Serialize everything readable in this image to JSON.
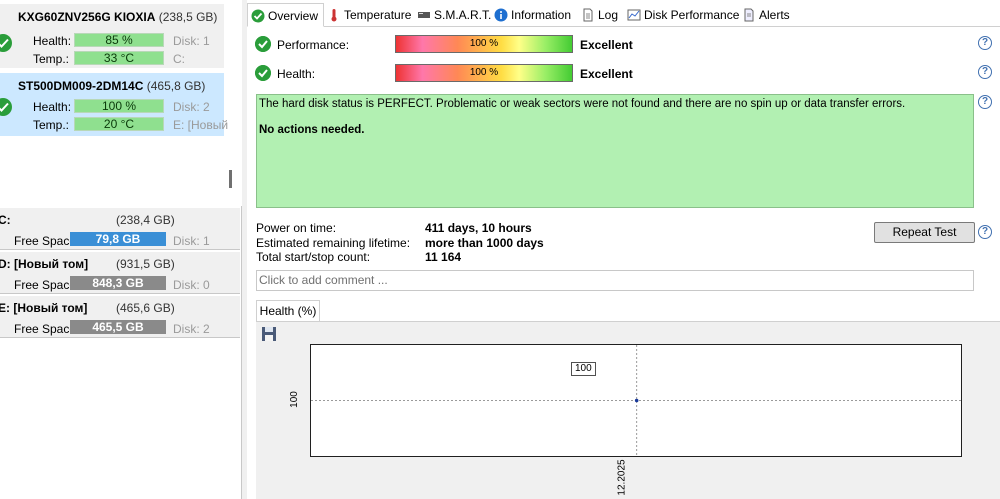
{
  "disks": [
    {
      "model": "KXG60ZNV256G KIOXIA",
      "capacity": "(238,5 GB)",
      "health_label": "Health:",
      "health": "85 %",
      "health_side": "Disk: 1",
      "temp_label": "Temp.:",
      "temp": "33 °C",
      "temp_side": "C:"
    },
    {
      "model": "ST500DM009-2DM14C",
      "capacity": "(465,8 GB)",
      "health_label": "Health:",
      "health": "100 %",
      "health_side": "Disk: 2",
      "temp_label": "Temp.:",
      "temp": "20 °C",
      "temp_side": "E: [Новый"
    }
  ],
  "volumes": [
    {
      "name": "C:",
      "capacity": "(238,4 GB)",
      "free_label": "Free Space",
      "free": "79,8 GB",
      "disk": "Disk: 1"
    },
    {
      "name": "D: [Новый том]",
      "capacity": "(931,5 GB)",
      "free_label": "Free Space",
      "free": "848,3 GB",
      "disk": "Disk: 0"
    },
    {
      "name": "E: [Новый том]",
      "capacity": "(465,6 GB)",
      "free_label": "Free Space",
      "free": "465,5 GB",
      "disk": "Disk: 2"
    }
  ],
  "tabs": [
    "Overview",
    "Temperature",
    "S.M.A.R.T.",
    "Information",
    "Log",
    "Disk Performance",
    "Alerts"
  ],
  "performance": {
    "label": "Performance:",
    "value": "100 %",
    "level": 1.0,
    "status": "Excellent"
  },
  "health": {
    "label": "Health:",
    "value": "100 %",
    "level": 1.0,
    "status": "Excellent"
  },
  "message": {
    "line1": "The hard disk status is PERFECT. Problematic or weak sectors were not found and there are no spin up or data transfer errors.",
    "line2": "No actions needed."
  },
  "info": [
    {
      "label": "Power on time:",
      "value": "411 days, 10 hours"
    },
    {
      "label": "Estimated remaining lifetime:",
      "value": "more than 1000 days"
    },
    {
      "label": "Total start/stop count:",
      "value": "11 164"
    }
  ],
  "repeat_test": "Repeat Test",
  "comment_placeholder": "Click to add comment ...",
  "chart_tab": "Health (%)",
  "chart_data": {
    "type": "scatter",
    "title": "Health (%)",
    "x": [
      "12.2025"
    ],
    "series": [
      {
        "values": [
          100
        ]
      }
    ],
    "ytick": "100",
    "data_labels": [
      "100"
    ]
  }
}
